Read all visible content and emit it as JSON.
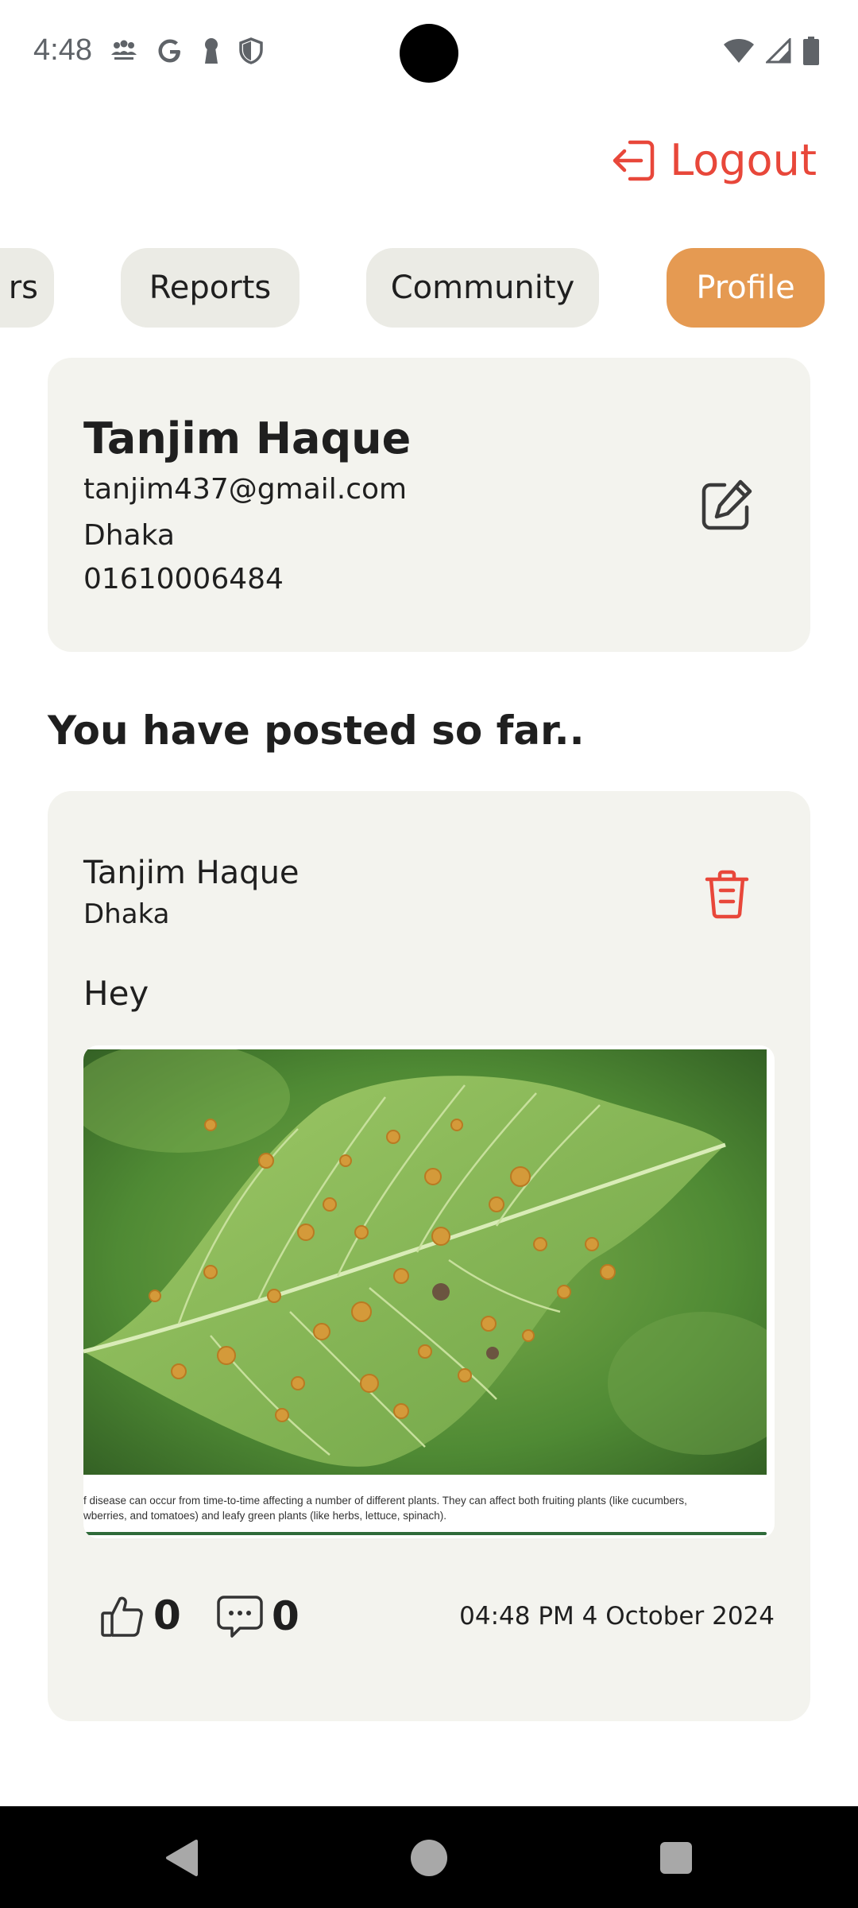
{
  "status_bar": {
    "time": "4:48",
    "left_icons": [
      "group-icon",
      "google-icon",
      "keyhole-icon",
      "shield-icon"
    ],
    "right_icons": [
      "wifi-icon",
      "signal-icon",
      "battery-icon"
    ]
  },
  "header": {
    "logout_label": "Logout"
  },
  "tabs": [
    {
      "label": "rs",
      "active": false
    },
    {
      "label": "Reports",
      "active": false
    },
    {
      "label": "Community",
      "active": false
    },
    {
      "label": "Profile",
      "active": true
    }
  ],
  "profile": {
    "name": "Tanjim Haque",
    "email": "tanjim437@gmail.com",
    "city": "Dhaka",
    "phone": "01610006484"
  },
  "posts_section": {
    "title": "You have posted so far.."
  },
  "post": {
    "author": "Tanjim Haque",
    "city": "Dhaka",
    "text": "Hey",
    "image_caption_line1": "f disease can occur from time-to-time affecting a number of different plants. They can affect both fruiting plants (like cucumbers,",
    "image_caption_line2": "wberries, and tomatoes) and leafy green plants (like herbs, lettuce, spinach).",
    "likes": "0",
    "comments": "0",
    "timestamp": "04:48 PM 4 October 2024"
  },
  "colors": {
    "accent": "#e59a52",
    "danger": "#e8473a",
    "card": "#f3f3ee",
    "tab": "#ebebe5"
  }
}
